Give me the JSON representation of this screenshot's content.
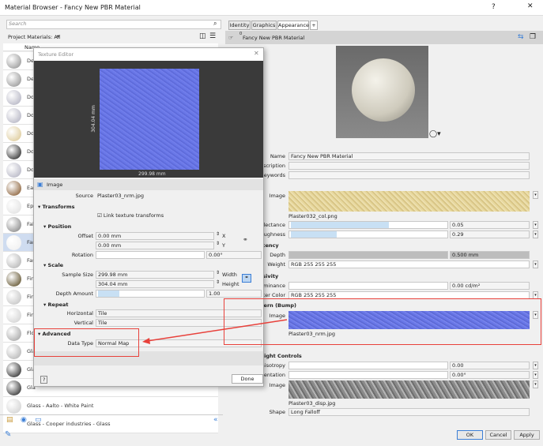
{
  "window": {
    "title": "Material Browser - Fancy New PBR Material",
    "help": "?",
    "close": "✕"
  },
  "browser": {
    "search_placeholder": "Search",
    "filter": "Project Materials: All",
    "column_name": "Name",
    "materials": [
      "Def",
      "Def",
      "Doo",
      "Doo",
      "Doo",
      "Doo",
      "Doo",
      "Eart",
      "Epo",
      "Fab",
      "Fan",
      "Fas",
      "Fini",
      "Fini",
      "Fini",
      "Flo",
      "Gla",
      "Gla",
      "Gla",
      "Glass - Aalto - White Paint",
      "Glass - Cooper industries - Glass"
    ],
    "selected_index": 10
  },
  "texture_editor": {
    "title": "Texture Editor",
    "width_dim": "299.98 mm",
    "height_dim": "304.04 mm",
    "section": "Image",
    "source_label": "Source",
    "source": "Plaster03_nrm.jpg",
    "transforms": "Transforms",
    "link_label": "Link texture transforms",
    "link_checked": true,
    "position": "Position",
    "offset_label": "Offset",
    "offset_x": "0.00 mm",
    "offset_y": "0.00 mm",
    "x": "X",
    "y": "Y",
    "rotation_label": "Rotation",
    "rotation": "0.00°",
    "scale": "Scale",
    "sample_label": "Sample Size",
    "sample_w": "299.98 mm",
    "sample_h": "304.04 mm",
    "width": "Width",
    "height": "Height",
    "depth_label": "Depth Amount",
    "depth": "1.00",
    "depth_fraction": 0.2,
    "repeat": "Repeat",
    "horizontal_label": "Horizontal",
    "horizontal": "Tile",
    "vertical_label": "Vertical",
    "vertical": "Tile",
    "advanced": "Advanced",
    "datatype_label": "Data Type",
    "datatype": "Normal Map",
    "help": "?",
    "done": "Done"
  },
  "editor": {
    "tabs": [
      "Identity",
      "Graphics",
      "Appearance"
    ],
    "active_tab": 2,
    "add_tab": "+",
    "count": "0",
    "material_name": "Fancy New PBR Material",
    "name_label": "Name",
    "name": "Fancy New PBR Material",
    "description_label": "Description",
    "keywords_label": "Keywords",
    "image_label": "Image",
    "color_file": "Plaster032_col.png",
    "reflectance_label": "Reflectance",
    "reflectance": "0.05",
    "reflectance_fraction": 0.62,
    "roughness_label": "Roughness",
    "roughness": "0.29",
    "roughness_fraction": 0.29,
    "translucency": "Translucency",
    "depth_label": "Depth",
    "depth": "0.500 mm",
    "weight_label": "Weight",
    "weight": "RGB 255 255 255",
    "emissivity": "Emissivity",
    "luminance_label": "Luminance",
    "luminance": "0.00 cd/m²",
    "filter_label": "Filter Color",
    "filter": "RGB 255 255 255",
    "relief": "Relief Pattern (Bump)",
    "bump_label": "Image",
    "bump_file": "Plaster03_nrm.jpg",
    "highlight": "Highlight Controls",
    "anisotropy_label": "Anisotropy",
    "anisotropy": "0.00",
    "orientation_label": "Orientation",
    "orientation": "0.00°",
    "hl_image_label": "Image",
    "disp_file": "Plaster03_disp.jpg",
    "shape_label": "Shape",
    "shape": "Long Falloff"
  },
  "buttons": {
    "ok": "OK",
    "cancel": "Cancel",
    "apply": "Apply"
  },
  "colors": {
    "accent": "#3c7fd6",
    "annotation": "#e8413b",
    "normal_map": "#6a78e8"
  }
}
